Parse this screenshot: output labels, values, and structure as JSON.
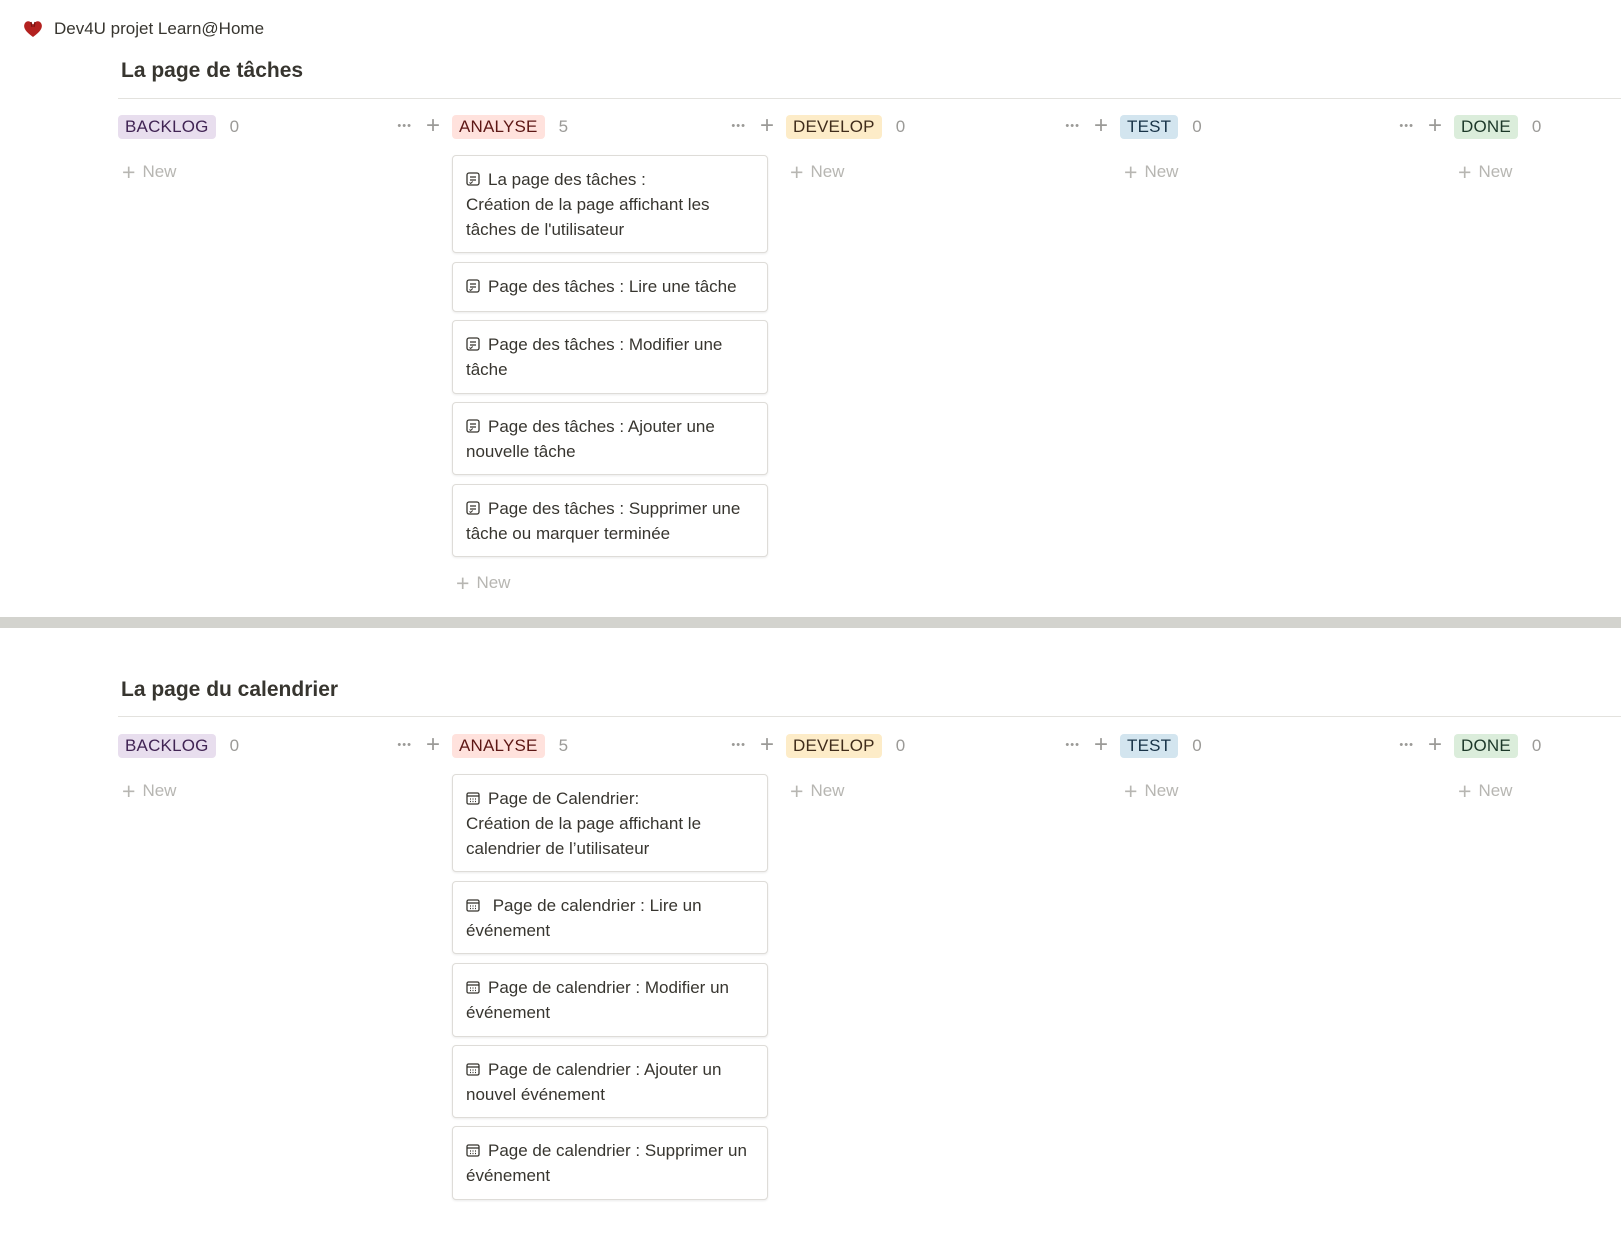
{
  "workspace": {
    "title": "Dev4U projet Learn@Home"
  },
  "boards": [
    {
      "title": "La page de tâches",
      "columns": [
        {
          "label": "BACKLOG",
          "count": "0",
          "new_label": "New"
        },
        {
          "label": "ANALYSE",
          "count": "5",
          "new_label": "New",
          "cards": [
            "La page des tâches :\nCréation de la page affichant les tâches de l'utilisateur",
            "Page des tâches : Lire une tâche",
            "Page des tâches :  Modifier une tâche",
            "Page des tâches : Ajouter une nouvelle tâche",
            "Page des tâches : Supprimer une tâche ou marquer terminée"
          ]
        },
        {
          "label": "DEVELOP",
          "count": "0",
          "new_label": "New"
        },
        {
          "label": "TEST",
          "count": "0",
          "new_label": "New"
        },
        {
          "label": "DONE",
          "count": "0",
          "new_label": "New"
        }
      ]
    },
    {
      "title": "La page du calendrier",
      "columns": [
        {
          "label": "BACKLOG",
          "count": "0",
          "new_label": "New"
        },
        {
          "label": "ANALYSE",
          "count": "5",
          "new_label": "New",
          "cards": [
            "Page de Calendrier:\nCréation de la page affichant le calendrier de l’utilisateur",
            " Page de calendrier : Lire un événement",
            "Page de calendrier : Modifier un événement",
            "Page de calendrier : Ajouter un nouvel événement",
            "Page de calendrier : Supprimer un événement"
          ]
        },
        {
          "label": "DEVELOP",
          "count": "0",
          "new_label": "New"
        },
        {
          "label": "TEST",
          "count": "0",
          "new_label": "New"
        },
        {
          "label": "DONE",
          "count": "0",
          "new_label": "New"
        }
      ]
    }
  ],
  "tag_colors": {
    "BACKLOG": {
      "bg": "#e8deee",
      "fg": "#412454"
    },
    "ANALYSE": {
      "bg": "#ffe2dd",
      "fg": "#5d1715"
    },
    "DEVELOP": {
      "bg": "#fdecc8",
      "fg": "#402c1b"
    },
    "TEST": {
      "bg": "#d3e5ef",
      "fg": "#183347"
    },
    "DONE": {
      "bg": "#dbeddb",
      "fg": "#1c3829"
    }
  },
  "icons": {
    "logo": "heart-logo-icon",
    "board1_card": "task-icon",
    "board2_card": "calendar-icon",
    "more": "more-dots-icon",
    "add": "plus-icon"
  }
}
